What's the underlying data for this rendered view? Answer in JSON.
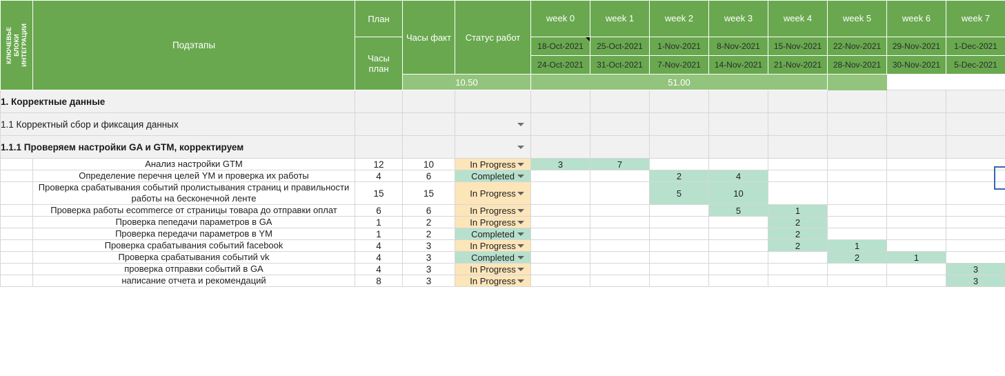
{
  "header": {
    "key_blocks_label": "КЛЮЧЕВЬЕ\nБЛОКИ\nИНТЕГРАЦИИ",
    "substages_label": "Подэтапы",
    "plan_label": "План",
    "plan_hours_label": "Часы\nплан",
    "fact_hours_label": "Часы факт",
    "status_label": "Статус работ",
    "weeks": [
      {
        "name": "week 0",
        "start": "18-Oct-2021",
        "end": "24-Oct-2021",
        "has_comment": true
      },
      {
        "name": "week 1",
        "start": "25-Oct-2021",
        "end": "31-Oct-2021",
        "has_comment": false
      },
      {
        "name": "week 2",
        "start": "1-Nov-2021",
        "end": "7-Nov-2021",
        "has_comment": false
      },
      {
        "name": "week 3",
        "start": "8-Nov-2021",
        "end": "14-Nov-2021",
        "has_comment": false
      },
      {
        "name": "week 4",
        "start": "15-Nov-2021",
        "end": "21-Nov-2021",
        "has_comment": false
      },
      {
        "name": "week 5",
        "start": "22-Nov-2021",
        "end": "28-Nov-2021",
        "has_comment": false
      },
      {
        "name": "week 6",
        "start": "29-Nov-2021",
        "end": "30-Nov-2021",
        "has_comment": false
      },
      {
        "name": "week 7",
        "start": "1-Dec-2021",
        "end": "5-Dec-2021",
        "has_comment": false
      }
    ],
    "summary_band": {
      "left_total": "10.50",
      "left_span": 2,
      "right_total": "51.00",
      "right_span": 5,
      "trailing_span": 1
    }
  },
  "colors": {
    "header_green": "#69a84f",
    "summary_green": "#93c47d",
    "group_grey": "#f1f1f1",
    "in_progress": "#fce5b9",
    "completed": "#b7e1cd",
    "gantt_fill": "#b7e1cd",
    "selection_blue": "#3367b0",
    "grid_line": "#d6d6d6"
  },
  "status_options": [
    "In Progress",
    "Completed"
  ],
  "rows": [
    {
      "type": "group",
      "level": 1,
      "label": "1. Корректные данные",
      "plan": "",
      "fact": "",
      "status": "",
      "caret": false,
      "weeks": [
        "",
        "",
        "",
        "",
        "",
        "",
        "",
        ""
      ]
    },
    {
      "type": "group",
      "level": 2,
      "label": "1.1 Корректный сбор и фиксация данных",
      "plan": "",
      "fact": "",
      "status": "",
      "caret": true,
      "weeks": [
        "",
        "",
        "",
        "",
        "",
        "",
        "",
        ""
      ]
    },
    {
      "type": "group",
      "level": 3,
      "label": "1.1.1 Проверяем настройки GA и GTM, корректируем",
      "plan": "",
      "fact": "",
      "status": "",
      "caret": true,
      "weeks": [
        "",
        "",
        "",
        "",
        "",
        "",
        "",
        ""
      ]
    },
    {
      "type": "task",
      "label": "Анализ настройки GTM",
      "plan": "12",
      "fact": "10",
      "status": "In Progress",
      "weeks": [
        "3",
        "7",
        "",
        "",
        "",
        "",
        "",
        ""
      ]
    },
    {
      "type": "task",
      "label": "Определение перечня целей YM и проверка их работы",
      "plan": "4",
      "fact": "6",
      "status": "Completed",
      "weeks": [
        "",
        "",
        "2",
        "4",
        "",
        "",
        "",
        ""
      ]
    },
    {
      "type": "task",
      "label": "Проверка срабатывания событий пролистывания страниц и правильности работы на бесконечной ленте",
      "plan": "15",
      "fact": "15",
      "status": "In Progress",
      "weeks": [
        "",
        "",
        "5",
        "10",
        "",
        "",
        "",
        ""
      ]
    },
    {
      "type": "task",
      "label": "Проверка работы ecommerce  от страницы товара до отправки оплат",
      "plan": "6",
      "fact": "6",
      "status": "In Progress",
      "weeks": [
        "",
        "",
        "",
        "5",
        "1",
        "",
        "",
        ""
      ]
    },
    {
      "type": "task",
      "label": "Проверка пепедачи параметров в GA",
      "plan": "1",
      "fact": "2",
      "status": "In Progress",
      "weeks": [
        "",
        "",
        "",
        "",
        "2",
        "",
        "",
        ""
      ]
    },
    {
      "type": "task",
      "label": "Проверка передачи параметров в YM",
      "plan": "1",
      "fact": "2",
      "status": "Completed",
      "weeks": [
        "",
        "",
        "",
        "",
        "2",
        "",
        "",
        ""
      ]
    },
    {
      "type": "task",
      "label": "Проверка срабатывания событий facebook",
      "plan": "4",
      "fact": "3",
      "status": "In Progress",
      "weeks": [
        "",
        "",
        "",
        "",
        "2",
        "1",
        "",
        ""
      ]
    },
    {
      "type": "task",
      "label": "Проверка срабатывания событий vk",
      "plan": "4",
      "fact": "3",
      "status": "Completed",
      "weeks": [
        "",
        "",
        "",
        "",
        "",
        "2",
        "1",
        ""
      ]
    },
    {
      "type": "task",
      "label": "проверка отправки событий в GA",
      "plan": "4",
      "fact": "3",
      "status": "In Progress",
      "weeks": [
        "",
        "",
        "",
        "",
        "",
        "",
        "",
        "3"
      ]
    },
    {
      "type": "task",
      "label": "написание отчета и рекомендаций",
      "plan": "8",
      "fact": "3",
      "status": "In Progress",
      "weeks": [
        "",
        "",
        "",
        "",
        "",
        "",
        "",
        "3"
      ]
    }
  ]
}
